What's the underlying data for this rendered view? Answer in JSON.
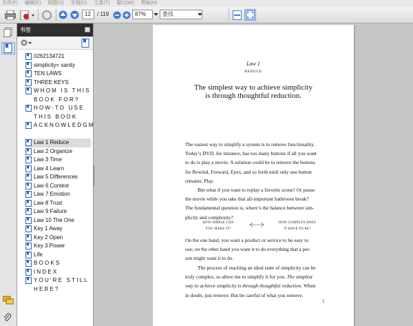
{
  "menu": [
    "文件(F)",
    "编辑(E)",
    "视图(V)",
    "文档(D)",
    "工具(T)",
    "窗口(W)",
    "帮助(H)"
  ],
  "toolbar": {
    "page_current": "12",
    "page_total": "/ 119",
    "zoom": "87%",
    "search_placeholder": "查找"
  },
  "panel": {
    "title": "书签",
    "bookmarks": [
      {
        "label": "0262134721",
        "spaced": false
      },
      {
        "label": "simplicity= sanity",
        "spaced": false
      },
      {
        "label": "TEN LAWS",
        "spaced": false
      },
      {
        "label": "THREE KEYS",
        "spaced": false
      },
      {
        "label": "WHOM IS THIS BOOK FOR?",
        "spaced": true
      },
      {
        "label": "HOW-TO USE THIS BOOK",
        "spaced": true
      },
      {
        "label": "ACKNOWLEDGMENTS",
        "spaced": true
      },
      {
        "label": "Law 1 Reduce",
        "spaced": false,
        "selected": true
      },
      {
        "label": "Law 2 Organize",
        "spaced": false
      },
      {
        "label": "Law 3 Time",
        "spaced": false
      },
      {
        "label": "Law 4 Learn",
        "spaced": false
      },
      {
        "label": "Law 5 Differences",
        "spaced": false
      },
      {
        "label": "Law 6 Context",
        "spaced": false
      },
      {
        "label": "Law 7 Emotion",
        "spaced": false
      },
      {
        "label": "Law 8 Trust",
        "spaced": false
      },
      {
        "label": "Law 9 Failure",
        "spaced": false
      },
      {
        "label": "Law 10 The One",
        "spaced": false
      },
      {
        "label": "Key 1 Away",
        "spaced": false
      },
      {
        "label": "Key 2 Open",
        "spaced": false
      },
      {
        "label": "Key 3 Power",
        "spaced": false
      },
      {
        "label": "Life",
        "spaced": false
      },
      {
        "label": "BOOKS",
        "spaced": true
      },
      {
        "label": "INDEX",
        "spaced": true
      },
      {
        "label": "YOU'RE STILL HERE?",
        "spaced": true
      }
    ]
  },
  "page": {
    "law": "Law 1",
    "law_name": "REDUCE",
    "heading_1": "The simplest way to achieve simplicity",
    "heading_2": "is through thoughtful reduction.",
    "para1": [
      "The easiest way to simplify a system is to remove functionality.",
      "Today’s DVD, for instance, has too many buttons if all you want",
      "to do is play a movie. A solution could be to remove the buttons",
      "for Rewind, Forward, Eject, and so forth until only one button",
      "remains: Play."
    ],
    "para2": [
      "But what if you want to replay a favorite scene? Or pause",
      "the movie while you take that all-important bathroom break?",
      "The fundamental question is, where’s the balance between sim-",
      "plicity and complexity?"
    ],
    "diagram": {
      "left_1": "HOW SIMPLE CAN",
      "left_2": "YOU MAKE IT?",
      "right_1": "HOW COMPLEX DOES",
      "right_2": "IT HAVE TO BE?"
    },
    "para3": [
      "On the one hand, you want a product or service to be easy to",
      "use; on the other hand you want it to do everything that a per-",
      "son might want it to do."
    ],
    "para4_l1": "The process of reaching an ideal state of simplicity can be",
    "para4_l2a": "truly complex, so allow me to simplify it for you.",
    "para4_l2b": "The simplest",
    "para4_l3a": "way to achieve simplicity is through thoughtful reduction.",
    "para4_l3b": "When",
    "para4_l4": "in doubt, just remove. But be careful of what you remove.",
    "page_number": "1"
  },
  "colors": {
    "panel_header": "#2f2f2f",
    "selected_bookmark": "#dcdcdc",
    "toolbar_blue": "#3d7ad6"
  }
}
